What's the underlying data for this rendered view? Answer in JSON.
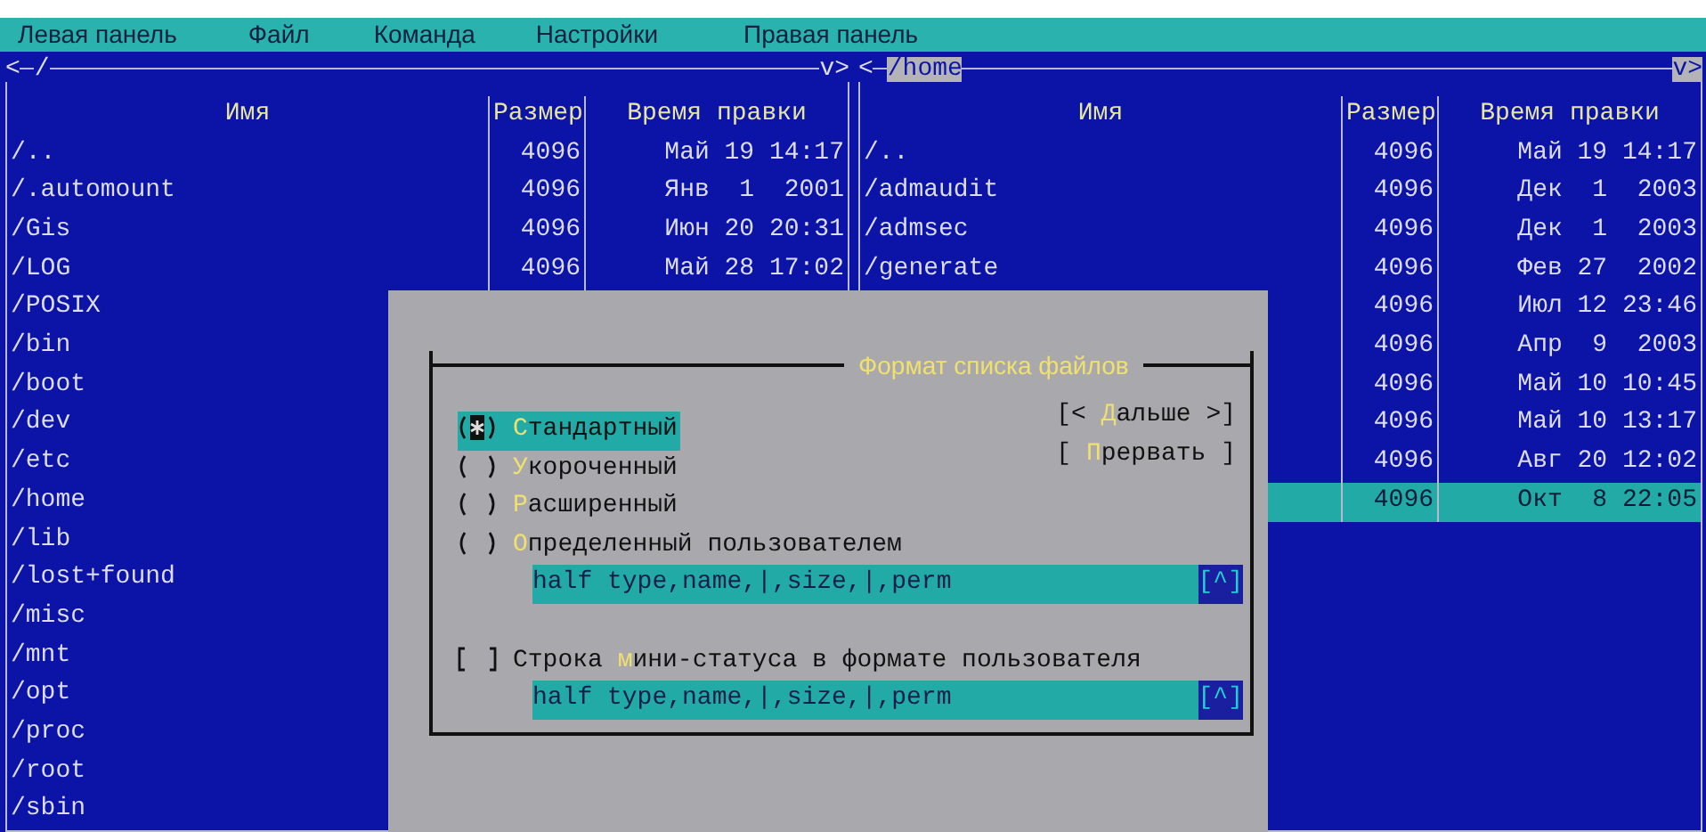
{
  "menu": [
    {
      "label": "Левая панель"
    },
    {
      "label": "Файл"
    },
    {
      "label": "Команда"
    },
    {
      "label": "Настройки"
    },
    {
      "label": "Правая панель"
    }
  ],
  "left_panel": {
    "active": false,
    "back": "<",
    "path": "/",
    "view": "v>",
    "columns": [
      "Имя",
      "Размер",
      "Время правки"
    ],
    "rows": [
      {
        "name": "/..",
        "size": "4096",
        "time": "Май 19 14:17",
        "selected": false
      },
      {
        "name": "/.automount",
        "size": "4096",
        "time": "Янв  1  2001",
        "selected": false
      },
      {
        "name": "/Gis",
        "size": "4096",
        "time": "Июн 20 20:31",
        "selected": false
      },
      {
        "name": "/LOG",
        "size": "4096",
        "time": "Май 28 17:02",
        "selected": false
      },
      {
        "name": "/POSIX",
        "selected": false
      },
      {
        "name": "/bin",
        "selected": false
      },
      {
        "name": "/boot",
        "selected": false
      },
      {
        "name": "/dev",
        "selected": false
      },
      {
        "name": "/etc",
        "selected": false
      },
      {
        "name": "/home",
        "selected": false
      },
      {
        "name": "/lib",
        "selected": false
      },
      {
        "name": "/lost+found",
        "selected": false
      },
      {
        "name": "/misc",
        "selected": false
      },
      {
        "name": "/mnt",
        "selected": false
      },
      {
        "name": "/opt",
        "selected": false
      },
      {
        "name": "/proc",
        "selected": false
      },
      {
        "name": "/root",
        "selected": false
      },
      {
        "name": "/sbin",
        "selected": false
      }
    ]
  },
  "right_panel": {
    "active": true,
    "back": "<",
    "path": "/home",
    "view": "v>",
    "columns": [
      "Имя",
      "Размер",
      "Время правки"
    ],
    "rows": [
      {
        "name": "/..",
        "size": "4096",
        "time": "Май 19 14:17",
        "selected": false
      },
      {
        "name": "/admaudit",
        "size": "4096",
        "time": "Дек  1  2003",
        "selected": false
      },
      {
        "name": "/admsec",
        "size": "4096",
        "time": "Дек  1  2003",
        "selected": false
      },
      {
        "name": "/generate",
        "size": "4096",
        "time": "Фев 27  2002",
        "selected": false
      },
      {
        "size": "4096",
        "time": "Июл 12 23:46",
        "selected": false
      },
      {
        "size": "4096",
        "time": "Апр  9  2003",
        "selected": false
      },
      {
        "size": "4096",
        "time": "Май 10 10:45",
        "selected": false
      },
      {
        "size": "4096",
        "time": "Май 10 13:17",
        "selected": false
      },
      {
        "size": "4096",
        "time": "Авг 20 12:02",
        "selected": false
      },
      {
        "size": "4096",
        "time": "Окт  8 22:05",
        "selected": true
      }
    ]
  },
  "dialog": {
    "title": "Формат списка файлов",
    "options": [
      {
        "label": "**С**тандартный",
        "selected": true,
        "focused": true
      },
      {
        "label": "**У**короченный",
        "selected": false,
        "focused": false
      },
      {
        "label": "**Р**асширенный",
        "selected": false,
        "focused": false
      },
      {
        "label": "**О**пределенный пользователем",
        "selected": false,
        "focused": false
      }
    ],
    "user_format": {
      "value": "half type,name,|,size,|,perm",
      "history": "[^]"
    },
    "mini_status": {
      "label": "Строка **м**ини-статуса в формате пользователя",
      "checked": false
    },
    "mini_status_format": {
      "value": "half type,name,|,size,|,perm",
      "history": "[^]"
    },
    "buttons": [
      {
        "label": "[< **Д**альше >]"
      },
      {
        "label": "[ **П**рервать ]"
      }
    ]
  }
}
